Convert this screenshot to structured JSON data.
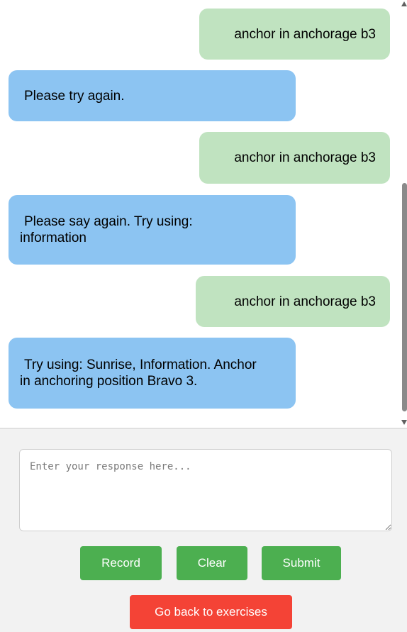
{
  "chat": {
    "messages": [
      {
        "role": "user",
        "text": "anchor in anchorage b3"
      },
      {
        "role": "bot",
        "text": "Please try again."
      },
      {
        "role": "user",
        "text": "anchor in anchorage b3"
      },
      {
        "role": "bot",
        "text": "Please say again. Try using: information"
      },
      {
        "role": "user",
        "text": "anchor in anchorage b3"
      },
      {
        "role": "bot",
        "text": "Try using: Sunrise, Information. Anchor in anchoring position Bravo 3."
      }
    ]
  },
  "input": {
    "placeholder": "Enter your response here...",
    "value": ""
  },
  "buttons": {
    "record": "Record",
    "clear": "Clear",
    "submit": "Submit",
    "back": "Go back to exercises"
  },
  "colors": {
    "user_bubble": "#c0e3c0",
    "bot_bubble": "#8cc4f2",
    "primary_button": "#4caf50",
    "danger_button": "#f44336"
  }
}
